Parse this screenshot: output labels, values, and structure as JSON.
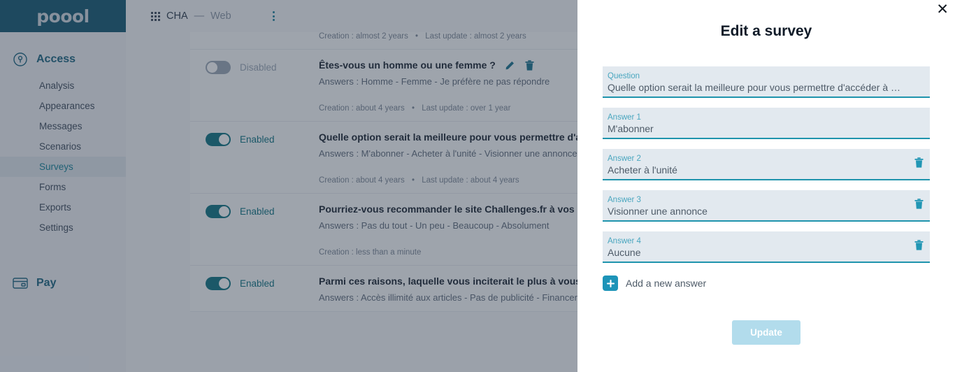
{
  "sidebar": {
    "logo": "poool",
    "groups": [
      {
        "name": "Access",
        "icon": "lock-keyhole-icon",
        "items": [
          {
            "label": "Analysis",
            "active": false
          },
          {
            "label": "Appearances",
            "active": false
          },
          {
            "label": "Messages",
            "active": false
          },
          {
            "label": "Scenarios",
            "active": false
          },
          {
            "label": "Surveys",
            "active": true
          },
          {
            "label": "Forms",
            "active": false
          },
          {
            "label": "Exports",
            "active": false
          },
          {
            "label": "Settings",
            "active": false
          }
        ]
      },
      {
        "name": "Pay",
        "icon": "credit-card-icon",
        "items": []
      }
    ]
  },
  "topbar": {
    "grid_icon": "apps-grid-icon",
    "app_name": "CHA",
    "app_separator": "—",
    "app_platform": "Web",
    "menu_icon": "kebab-menu-icon"
  },
  "survey_list": {
    "partial_top": {
      "meta_creation": "Creation : almost 2 years",
      "meta_update": "Last update : almost 2 years",
      "separator": "•"
    },
    "rows": [
      {
        "state_label": "Disabled",
        "enabled": false,
        "question": "Êtes-vous un homme ou une femme ?",
        "answers": "Answers : Homme - Femme - Je préfère ne pas répondre",
        "meta_creation": "Creation : about 4 years",
        "meta_update": "Last update : over 1 year",
        "separator": "•",
        "has_actions": true,
        "edit_icon": "pencil-icon",
        "delete_icon": "trash-icon"
      },
      {
        "state_label": "Enabled",
        "enabled": true,
        "question": "Quelle option serait la meilleure pour vous permettre d'accéder",
        "answers": "Answers : M'abonner - Acheter à l'unité - Visionner une annonce - Aucune",
        "meta_creation": "Creation : about 4 years",
        "meta_update": "Last update : about 4 years",
        "separator": "•",
        "has_actions": false,
        "edit_icon": "pencil-icon",
        "delete_icon": "trash-icon"
      },
      {
        "state_label": "Enabled",
        "enabled": true,
        "question": "Pourriez-vous recommander le site Challenges.fr à vos proches ?",
        "answers": "Answers : Pas du tout - Un peu - Beaucoup - Absolument",
        "meta_creation": "Creation : less than a minute",
        "meta_update": "",
        "separator": "",
        "has_actions": false,
        "edit_icon": "pencil-icon",
        "delete_icon": "trash-icon"
      },
      {
        "state_label": "Enabled",
        "enabled": true,
        "question": "Parmi ces raisons, laquelle vous inciterait le plus à vous abonner",
        "answers": "Answers : Accès illimité aux articles - Pas de publicité - Financer l'information -",
        "meta_creation": "",
        "meta_update": "",
        "separator": "",
        "has_actions": false,
        "edit_icon": "pencil-icon",
        "delete_icon": "trash-icon"
      }
    ]
  },
  "modal": {
    "title": "Edit a survey",
    "close_icon": "close-icon",
    "fields": [
      {
        "label": "Question",
        "value": "Quelle option serait la meilleure pour vous permettre d'accéder à cet ar…",
        "deletable": false
      },
      {
        "label": "Answer 1",
        "value": "M'abonner",
        "deletable": false
      },
      {
        "label": "Answer 2",
        "value": "Acheter à l'unité",
        "deletable": true
      },
      {
        "label": "Answer 3",
        "value": "Visionner une annonce",
        "deletable": true
      },
      {
        "label": "Answer 4",
        "value": "Aucune",
        "deletable": true
      }
    ],
    "add_answer_label": "Add a new answer",
    "add_icon": "plus-icon",
    "delete_icon": "trash-icon",
    "submit_label": "Update",
    "submit_disabled": true
  },
  "colors": {
    "brand_teal": "#115670",
    "accent_teal": "#1f94ad",
    "toggle_on": "#0b7180",
    "field_bg": "#e2e9ef",
    "submit_disabled_bg": "#b2dcec",
    "overlay": "rgba(46,57,76,0.45)"
  }
}
